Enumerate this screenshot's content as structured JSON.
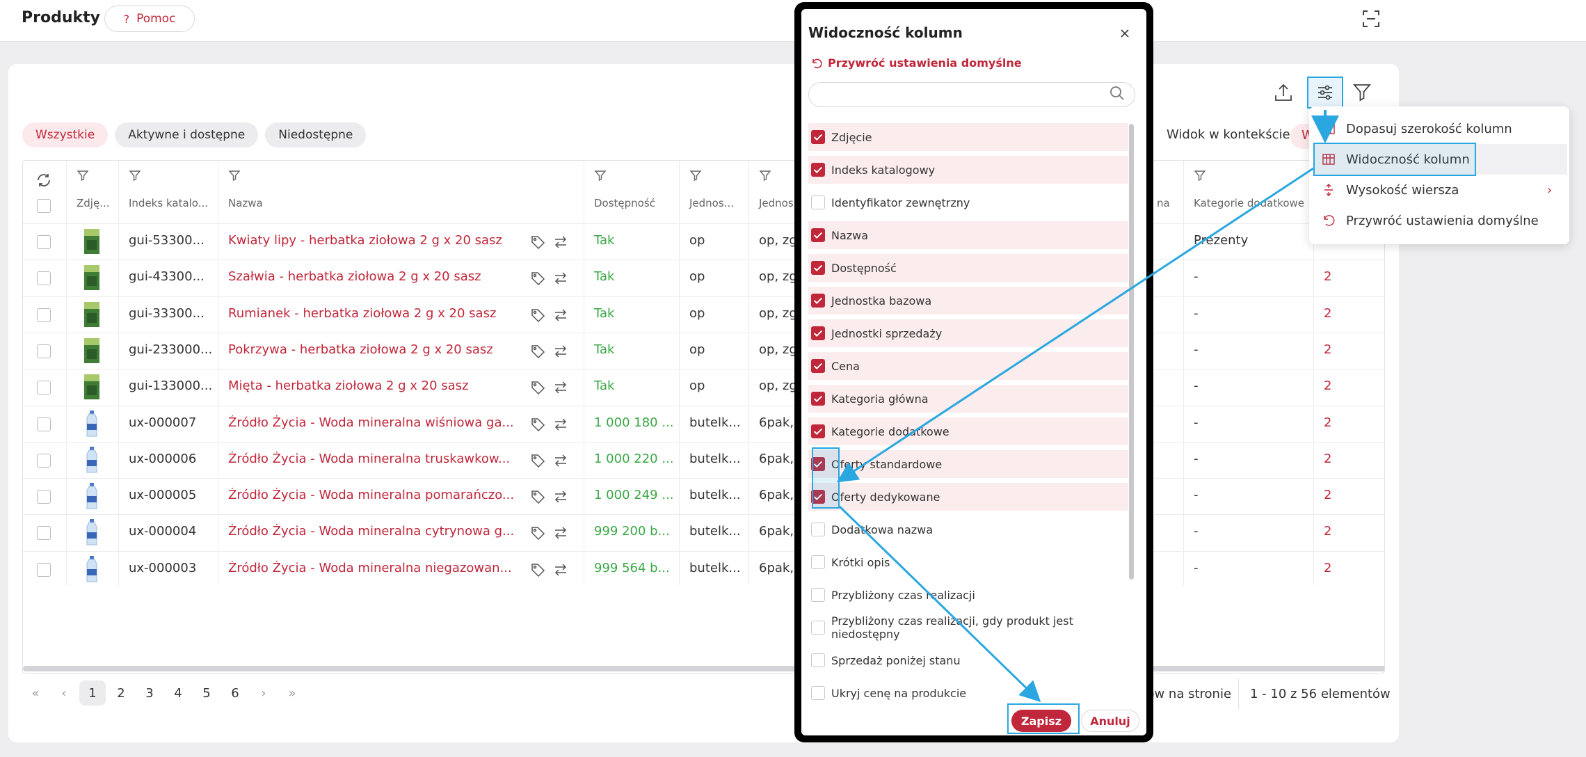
{
  "header": {
    "title": "Produkty",
    "help_label": "Pomoc",
    "help_icon": "?"
  },
  "tabs": [
    {
      "label": "Wszystkie",
      "active": true
    },
    {
      "label": "Aktywne i dostępne",
      "active": false
    },
    {
      "label": "Niedostępne",
      "active": false
    }
  ],
  "context_label": "Widok w kontekście:",
  "context_value": "W",
  "table": {
    "headers": {
      "photo": "Zdję...",
      "catalog_index": "Indeks katalo...",
      "name": "Nazwa",
      "availability": "Dostępność",
      "base_unit": "Jednos...",
      "sales_units": "Jednos",
      "hidden_col": "na",
      "extra_categories": "Kategorie dodatkowe"
    },
    "rows": [
      {
        "index": "gui-53300...",
        "name": "Kwiaty lipy - herbatka ziołowa 2 g x 20 sasz",
        "availability": "Tak",
        "unit": "op",
        "sales": "op, zg",
        "extra": "Prezenty",
        "last": "",
        "img": "tea"
      },
      {
        "index": "gui-43300...",
        "name": "Szałwia - herbatka ziołowa 2 g x 20 sasz",
        "availability": "Tak",
        "unit": "op",
        "sales": "op, zg",
        "extra": "-",
        "last": "2",
        "img": "tea"
      },
      {
        "index": "gui-33300...",
        "name": "Rumianek - herbatka ziołowa 2 g x 20 sasz",
        "availability": "Tak",
        "unit": "op",
        "sales": "op, zg",
        "extra": "-",
        "last": "2",
        "img": "tea"
      },
      {
        "index": "gui-233000...",
        "name": "Pokrzywa - herbatka ziołowa 2 g x 20 sasz",
        "availability": "Tak",
        "unit": "op",
        "sales": "op, zg",
        "extra": "-",
        "last": "2",
        "img": "tea"
      },
      {
        "index": "gui-133000...",
        "name": "Mięta - herbatka ziołowa 2 g x 20 sasz",
        "availability": "Tak",
        "unit": "op",
        "sales": "op, zg",
        "extra": "-",
        "last": "2",
        "img": "tea"
      },
      {
        "index": "ux-000007",
        "name": "Źródło Życia - Woda mineralna wiśniowa ga...",
        "availability": "1 000 180 ...",
        "unit": "butelk...",
        "sales": "6pak,",
        "extra": "-",
        "last": "2",
        "img": "bottle"
      },
      {
        "index": "ux-000006",
        "name": "Źródło Życia - Woda mineralna truskawkow...",
        "availability": "1 000 220 ...",
        "unit": "butelk...",
        "sales": "6pak,",
        "extra": "-",
        "last": "2",
        "img": "bottle"
      },
      {
        "index": "ux-000005",
        "name": "Źródło Życia - Woda mineralna pomarańczo...",
        "availability": "1 000 249 ...",
        "unit": "butelk...",
        "sales": "6pak,",
        "extra": "-",
        "last": "2",
        "img": "bottle"
      },
      {
        "index": "ux-000004",
        "name": "Źródło Życia - Woda mineralna cytrynowa g...",
        "availability": "999 200 b...",
        "unit": "butelk...",
        "sales": "6pak,",
        "extra": "-",
        "last": "2",
        "img": "bottle"
      },
      {
        "index": "ux-000003",
        "name": "Źródło Życia - Woda mineralna niegazowan...",
        "availability": "999 564 b...",
        "unit": "butelk...",
        "sales": "6pak,",
        "extra": "-",
        "last": "2",
        "img": "bottle"
      }
    ]
  },
  "pagination": {
    "pages": [
      "1",
      "2",
      "3",
      "4",
      "5",
      "6"
    ],
    "current": "1",
    "first": "«",
    "prev": "‹",
    "next": "›",
    "last": "»",
    "per_page_label": "ntów na stronie",
    "range": "1 - 10 z 56 elementów"
  },
  "settings_menu": [
    {
      "label": "Dopasuj szerokość kolumn",
      "icon": "fit-width-icon"
    },
    {
      "label": "Widoczność kolumn",
      "icon": "column-visibility-icon"
    },
    {
      "label": "Wysokość wiersza",
      "icon": "row-height-icon"
    },
    {
      "label": "Przywróć ustawienia domyślne",
      "icon": "restore-icon"
    }
  ],
  "modal": {
    "title": "Widoczność kolumn",
    "restore_label": "Przywróć ustawienia domyślne",
    "search_placeholder": "",
    "columns": [
      {
        "label": "Zdjęcie",
        "checked": true
      },
      {
        "label": "Indeks katalogowy",
        "checked": true
      },
      {
        "label": "Identyfikator zewnętrzny",
        "checked": false
      },
      {
        "label": "Nazwa",
        "checked": true
      },
      {
        "label": "Dostępność",
        "checked": true
      },
      {
        "label": "Jednostka bazowa",
        "checked": true
      },
      {
        "label": "Jednostki sprzedaży",
        "checked": true
      },
      {
        "label": "Cena",
        "checked": true
      },
      {
        "label": "Kategoria główna",
        "checked": true
      },
      {
        "label": "Kategorie dodatkowe",
        "checked": true
      },
      {
        "label": "Oferty standardowe",
        "checked": true
      },
      {
        "label": "Oferty dedykowane",
        "checked": true
      },
      {
        "label": "Dodatkowa nazwa",
        "checked": false
      },
      {
        "label": "Krótki opis",
        "checked": false
      },
      {
        "label": "Przybliżony czas realizacji",
        "checked": false
      },
      {
        "label": "Przybliżony czas realizacji, gdy produkt jest niedostępny",
        "checked": false
      },
      {
        "label": "Sprzedaż poniżej stanu",
        "checked": false
      },
      {
        "label": "Ukryj cenę na produkcie",
        "checked": false
      }
    ],
    "save_label": "Zapisz",
    "cancel_label": "Anuluj"
  },
  "colors": {
    "accent": "#c0273a",
    "available": "#3aa845",
    "highlight": "#2aa7e0"
  }
}
